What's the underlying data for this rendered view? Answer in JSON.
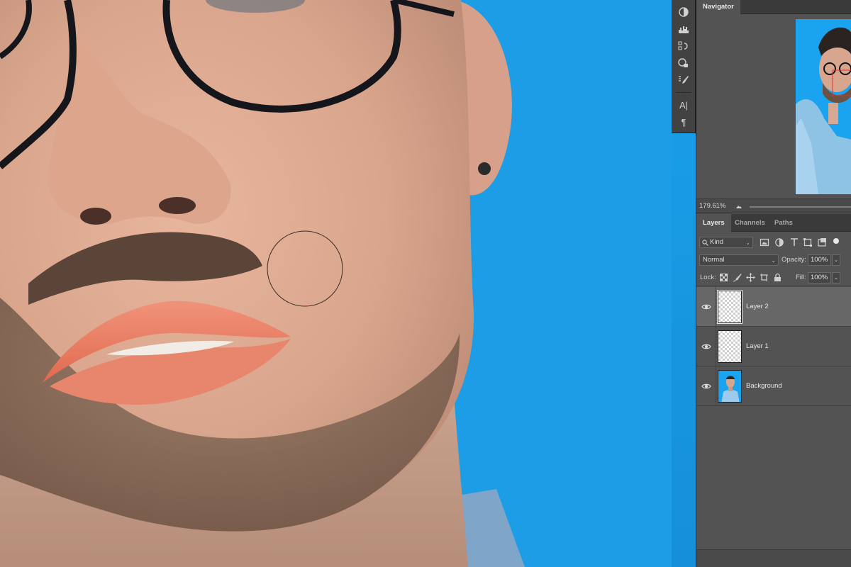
{
  "tools": {
    "icons": [
      "adjustments-icon",
      "histogram-icon",
      "history-icon",
      "properties-icon",
      "brush-settings-icon",
      "character-icon",
      "paragraph-icon"
    ],
    "character_glyph": "A|",
    "paragraph_glyph": "¶"
  },
  "navigator": {
    "tab_label": "Navigator",
    "zoom_value": "179.61%"
  },
  "layers_panel": {
    "tabs": [
      "Layers",
      "Channels",
      "Paths"
    ],
    "active_tab": "Layers",
    "filter_kind": "Kind",
    "blend_mode": "Normal",
    "opacity_label": "Opacity:",
    "opacity_value": "100%",
    "lock_label": "Lock:",
    "fill_label": "Fill:",
    "fill_value": "100%",
    "layers": [
      {
        "name": "Layer 2",
        "selected": true,
        "visible": true
      },
      {
        "name": "Layer 1",
        "selected": false,
        "visible": true
      },
      {
        "name": "Background",
        "selected": false,
        "visible": true
      }
    ]
  },
  "colors": {
    "backdrop_blue": "#1c9de6",
    "panel_bg": "#535353",
    "selected_row": "#676767"
  }
}
